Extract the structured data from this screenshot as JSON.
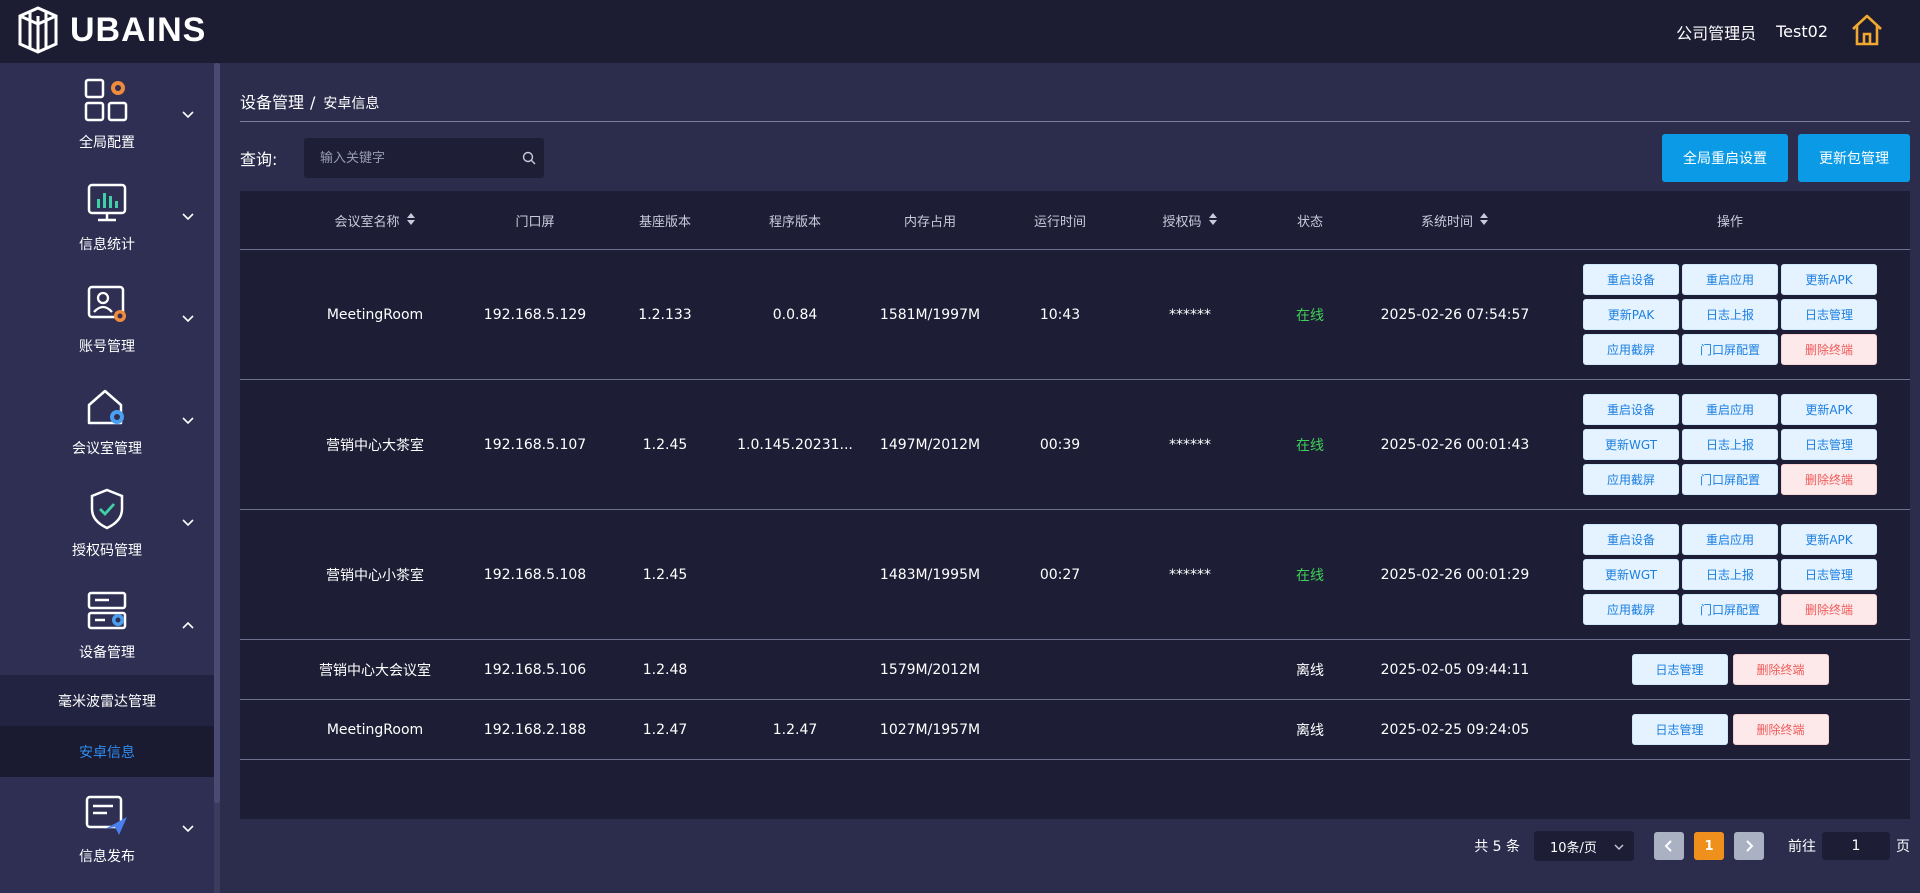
{
  "header": {
    "brand": "UBAINS",
    "role": "公司管理员",
    "username": "Test02",
    "home_icon": "home-icon",
    "accent_color": "#f0a830"
  },
  "sidebar": {
    "items": [
      {
        "label": "全局配置",
        "icon": "global-config-icon",
        "expanded": false
      },
      {
        "label": "信息统计",
        "icon": "statistics-icon",
        "expanded": false
      },
      {
        "label": "账号管理",
        "icon": "account-icon",
        "expanded": false
      },
      {
        "label": "会议室管理",
        "icon": "meeting-room-icon",
        "expanded": false
      },
      {
        "label": "授权码管理",
        "icon": "license-icon",
        "expanded": false
      },
      {
        "label": "设备管理",
        "icon": "device-icon",
        "expanded": true
      },
      {
        "label": "信息发布",
        "icon": "publish-icon",
        "expanded": false
      }
    ],
    "sub_items": [
      {
        "label": "毫米波雷达管理",
        "active": false
      },
      {
        "label": "安卓信息",
        "active": true
      }
    ]
  },
  "breadcrumb": {
    "parent": "设备管理",
    "separator": "/",
    "current": "安卓信息"
  },
  "search": {
    "label": "查询:",
    "placeholder": "输入关键字",
    "value": ""
  },
  "actions": {
    "global_restart": "全局重启设置",
    "update_package": "更新包管理"
  },
  "table": {
    "headers": {
      "room": "会议室名称",
      "door": "门口屏",
      "base": "基座版本",
      "prog": "程序版本",
      "mem": "内存占用",
      "uptime": "运行时间",
      "auth": "授权码",
      "status": "状态",
      "systime": "系统时间",
      "ops": "操作"
    },
    "rows": [
      {
        "room": "MeetingRoom",
        "door": "192.168.5.129",
        "base": "1.2.133",
        "prog": "0.0.84",
        "mem": "1581M/1997M",
        "uptime": "10:43",
        "auth": "******",
        "status": "在线",
        "systime": "2025-02-26 07:54:57",
        "ops": [
          "重启设备",
          "重启应用",
          "更新APK",
          "更新PAK",
          "日志上报",
          "日志管理",
          "应用截屏",
          "门口屏配置",
          "删除终端"
        ]
      },
      {
        "room": "营销中心大茶室",
        "door": "192.168.5.107",
        "base": "1.2.45",
        "prog": "1.0.145.20231...",
        "mem": "1497M/2012M",
        "uptime": "00:39",
        "auth": "******",
        "status": "在线",
        "systime": "2025-02-26 00:01:43",
        "ops": [
          "重启设备",
          "重启应用",
          "更新APK",
          "更新WGT",
          "日志上报",
          "日志管理",
          "应用截屏",
          "门口屏配置",
          "删除终端"
        ]
      },
      {
        "room": "营销中心小茶室",
        "door": "192.168.5.108",
        "base": "1.2.45",
        "prog": "",
        "mem": "1483M/1995M",
        "uptime": "00:27",
        "auth": "******",
        "status": "在线",
        "systime": "2025-02-26 00:01:29",
        "ops": [
          "重启设备",
          "重启应用",
          "更新APK",
          "更新WGT",
          "日志上报",
          "日志管理",
          "应用截屏",
          "门口屏配置",
          "删除终端"
        ]
      },
      {
        "room": "营销中心大会议室",
        "door": "192.168.5.106",
        "base": "1.2.48",
        "prog": "",
        "mem": "1579M/2012M",
        "uptime": "",
        "auth": "",
        "status": "离线",
        "systime": "2025-02-05 09:44:11",
        "ops": [
          "日志管理",
          "删除终端"
        ]
      },
      {
        "room": "MeetingRoom",
        "door": "192.168.2.188",
        "base": "1.2.47",
        "prog": "1.2.47",
        "mem": "1027M/1957M",
        "uptime": "",
        "auth": "",
        "status": "离线",
        "systime": "2025-02-25 09:24:05",
        "ops": [
          "日志管理",
          "删除终端"
        ]
      }
    ]
  },
  "pagination": {
    "total": "共 5 条",
    "page_size": "10条/页",
    "current_page": "1",
    "goto_label": "前往",
    "goto_value": "1",
    "page_suffix": "页"
  },
  "colors": {
    "online": "#3fcf58",
    "primary_button": "#0b9be6",
    "danger_text": "#ef5b5b",
    "active_page": "#f0901c"
  }
}
